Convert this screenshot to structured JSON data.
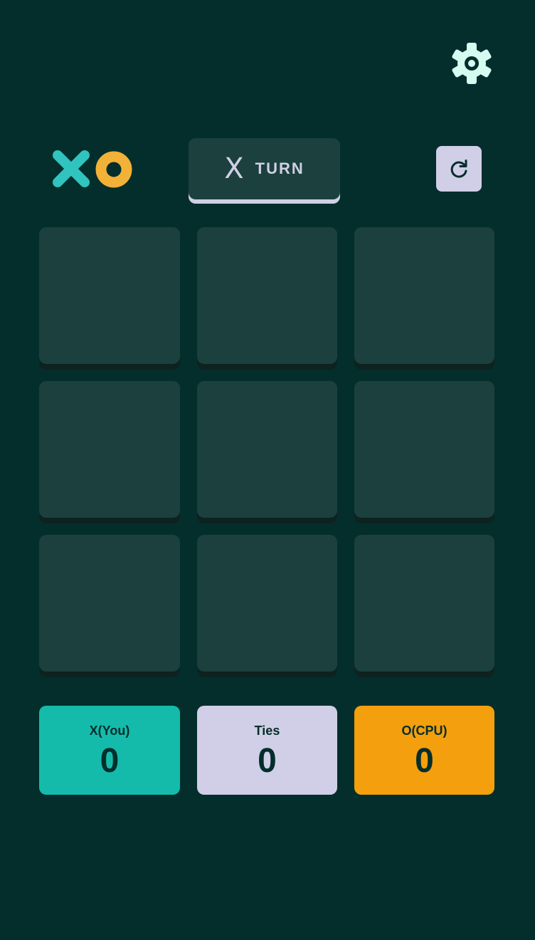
{
  "settings": {
    "icon": "gear-icon"
  },
  "header": {
    "logo": {
      "icons": [
        "x-mark-icon",
        "o-mark-icon"
      ]
    },
    "turn": {
      "mark": "X",
      "label": "TURN"
    },
    "restart": {
      "icon": "restart-icon"
    }
  },
  "board": {
    "cells": [
      "",
      "",
      "",
      "",
      "",
      "",
      "",
      "",
      ""
    ]
  },
  "scores": {
    "x": {
      "label": "X(You)",
      "value": "0"
    },
    "ties": {
      "label": "Ties",
      "value": "0"
    },
    "o": {
      "label": "O(CPU)",
      "value": "0"
    }
  },
  "colors": {
    "background": "#032e2b",
    "tile": "#1b403d",
    "x_accent": "#31c3bd",
    "o_accent": "#f2b137",
    "silver": "#d1cfe7",
    "x_score_bg": "#14bbab",
    "o_score_bg": "#f39f0e",
    "settings_icon": "#d6fbf0"
  }
}
